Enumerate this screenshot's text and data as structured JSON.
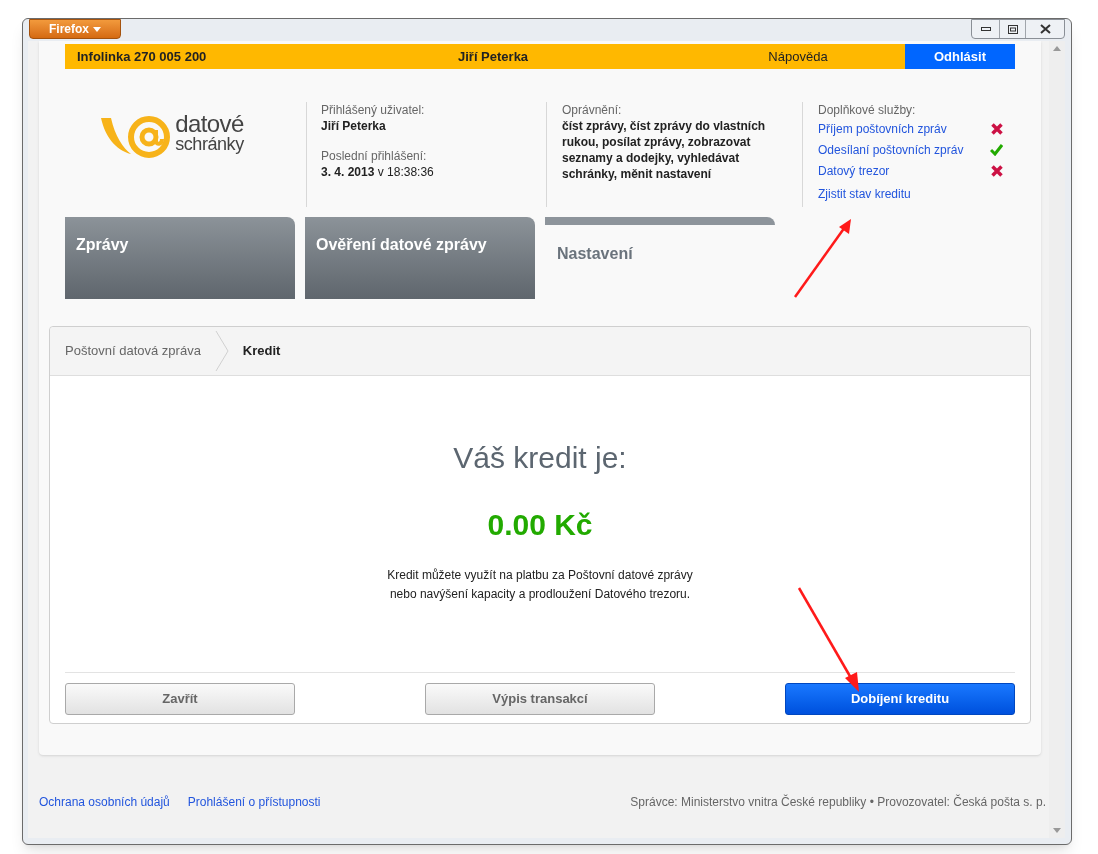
{
  "browser": {
    "menu_button": "Firefox"
  },
  "top_bar": {
    "hotline": "Infolinka 270 005 200",
    "user": "Jiří Peterka",
    "help": "Nápověda",
    "logout": "Odhlásit"
  },
  "logo": {
    "line_1": "datové",
    "line_2": "schránky"
  },
  "user_info": {
    "user_label": "Přihlášený uživatel:",
    "user_name": "Jiří Peterka",
    "last_login_label": "Poslední přihlášení:",
    "last_login_date": "3. 4. 2013",
    "last_login_time": "v 18:38:36"
  },
  "permissions": {
    "label": "Oprávnění:",
    "text": "číst zprávy, číst zprávy do vlastních rukou, posílat zprávy, zobrazovat seznamy a dodejky, vyhledávat schránky, měnit nastavení"
  },
  "services": {
    "label": "Doplňkové služby:",
    "items": [
      {
        "label": "Příjem poštovních zpráv",
        "active": false
      },
      {
        "label": "Odesílaní poštovních zpráv",
        "active": true
      },
      {
        "label": "Datový trezor",
        "active": false
      }
    ],
    "credit_link": "Zjistit stav kreditu"
  },
  "tabs": [
    {
      "label": "Zprávy",
      "selected": false
    },
    {
      "label": "Ověření datové zprávy",
      "selected": false
    },
    {
      "label": "Nastavení",
      "selected": true
    }
  ],
  "breadcrumb": [
    {
      "label": "Poštovní datová zpráva",
      "selected": false
    },
    {
      "label": "Kredit",
      "selected": true
    }
  ],
  "credit": {
    "heading": "Váš kredit je:",
    "amount": "0.00 Kč",
    "description_line_1": "Kredit můžete využít na platbu za Poštovní datové zprávy",
    "description_line_2": "nebo navýšení kapacity a prodloužení Datového trezoru."
  },
  "buttons": [
    {
      "label": "Zavřít",
      "kind": "secondary"
    },
    {
      "label": "Výpis transakcí",
      "kind": "secondary"
    },
    {
      "label": "Dobíjení kreditu",
      "kind": "primary"
    }
  ],
  "footer": {
    "links": [
      "Ochrana osobních údajů",
      "Prohlášení o přístupnosti"
    ],
    "operator": "Správce: Ministerstvo vnitra České republiky • Provozovatel: Česká pošta s. p."
  }
}
